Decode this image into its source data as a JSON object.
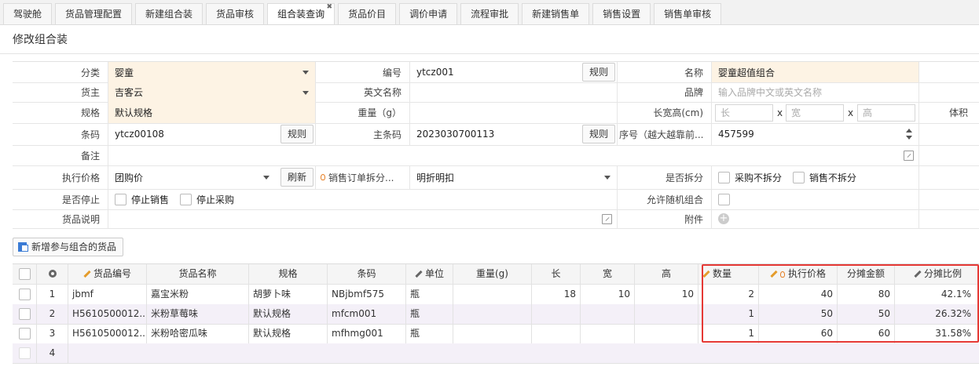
{
  "tabs": [
    {
      "label": "驾驶舱"
    },
    {
      "label": "货品管理配置"
    },
    {
      "label": "新建组合装"
    },
    {
      "label": "货品审核"
    },
    {
      "label": "组合装查询",
      "active": true
    },
    {
      "label": "货品价目"
    },
    {
      "label": "调价申请"
    },
    {
      "label": "流程审批"
    },
    {
      "label": "新建销售单"
    },
    {
      "label": "销售设置"
    },
    {
      "label": "销售单审核"
    }
  ],
  "page_title": "修改组合装",
  "form": {
    "category_label": "分类",
    "category_value": "婴童",
    "code_label": "编号",
    "code_value": "ytcz001",
    "rule_btn": "规则",
    "name_label": "名称",
    "name_value": "婴童超值组合",
    "owner_label": "货主",
    "owner_value": "吉客云",
    "en_name_label": "英文名称",
    "brand_label": "品牌",
    "brand_placeholder": "输入品牌中文或英文名称",
    "spec_label": "规格",
    "spec_value": "默认规格",
    "weight_label": "重量（g）",
    "lwh_label": "长宽高(cm)",
    "len_ph": "长",
    "wid_ph": "宽",
    "hei_ph": "高",
    "x_sep": "x",
    "volume_label": "体积",
    "barcode_label": "条码",
    "barcode_value": "ytcz00108",
    "main_barcode_label": "主条码",
    "main_barcode_value": "2023030700113",
    "seq_label": "序号（越大越靠前...",
    "seq_value": "457599",
    "remark_label": "备注",
    "exec_price_label": "执行价格",
    "exec_price_value": "团购价",
    "refresh_btn": "刷新",
    "split_order_label": "销售订单拆分...",
    "split_order_value": "明折明扣",
    "is_split_label": "是否拆分",
    "no_split_purchase": "采购不拆分",
    "no_split_sales": "销售不拆分",
    "is_stop_label": "是否停止",
    "stop_sales": "停止销售",
    "stop_purchase": "停止采购",
    "random_combo_label": "允许随机组合",
    "desc_label": "货品说明",
    "attach_label": "附件"
  },
  "add_button": "新增参与组合的货品",
  "grid": {
    "headers": [
      "货品编号",
      "货品名称",
      "规格",
      "条码",
      "单位",
      "重量(g)",
      "长",
      "宽",
      "高",
      "数量",
      "执行价格",
      "分摊金额",
      "分摊比例"
    ],
    "rows": [
      {
        "no": "1",
        "code": "jbmf",
        "name": "嘉宝米粉",
        "spec": "胡萝卜味",
        "barcode": "NBjbmf575",
        "unit": "瓶",
        "weight": "",
        "len": "18",
        "wid": "10",
        "hei": "10",
        "qty": "2",
        "price": "40",
        "amount": "80",
        "ratio": "42.1%"
      },
      {
        "no": "2",
        "code": "H5610500012...",
        "name": "米粉草莓味",
        "spec": "默认规格",
        "barcode": "mfcm001",
        "unit": "瓶",
        "weight": "",
        "len": "",
        "wid": "",
        "hei": "",
        "qty": "1",
        "price": "50",
        "amount": "50",
        "ratio": "26.32%"
      },
      {
        "no": "3",
        "code": "H5610500012...",
        "name": "米粉哈密瓜味",
        "spec": "默认规格",
        "barcode": "mfhmg001",
        "unit": "瓶",
        "weight": "",
        "len": "",
        "wid": "",
        "hei": "",
        "qty": "1",
        "price": "60",
        "amount": "60",
        "ratio": "31.58%"
      },
      {
        "no": "4",
        "code": "",
        "name": "",
        "spec": "",
        "barcode": "",
        "unit": "",
        "weight": "",
        "len": "",
        "wid": "",
        "hei": "",
        "qty": "",
        "price": "",
        "amount": "",
        "ratio": ""
      }
    ]
  },
  "colors": {
    "highlight": "#fdf3e4",
    "alert_border": "#e53935",
    "edit_pen": "#e49c2c"
  }
}
